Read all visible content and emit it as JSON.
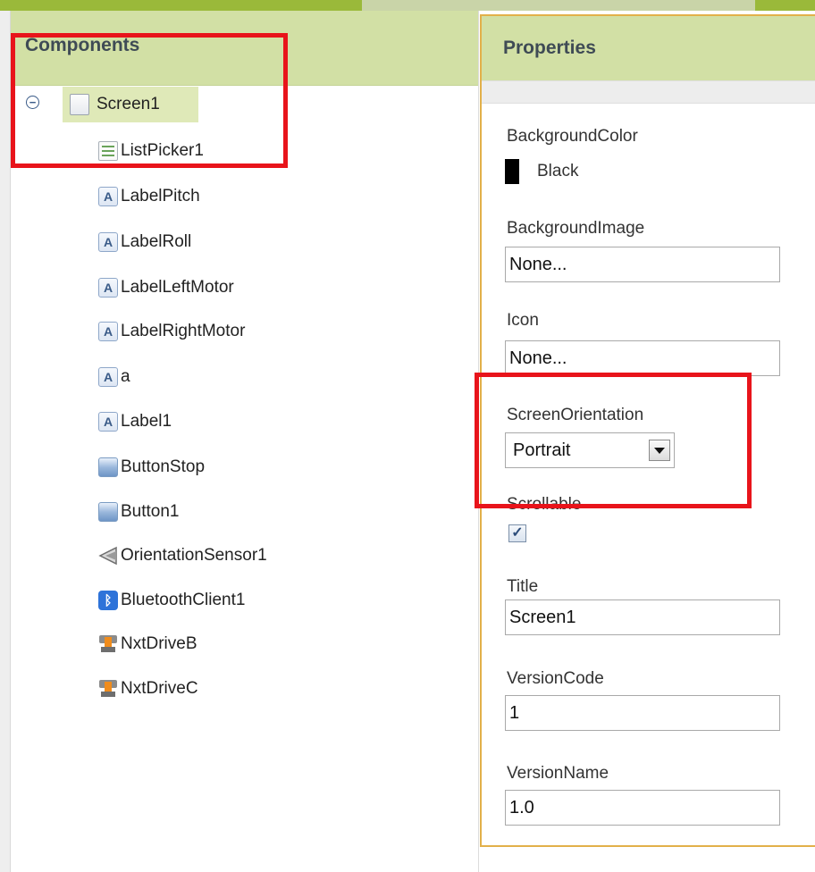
{
  "components": {
    "header": "Components",
    "collapse_toggle": "⊖",
    "screen": "Screen1",
    "items": [
      {
        "label": "ListPicker1",
        "icon": "list-picker-icon"
      },
      {
        "label": "LabelPitch",
        "icon": "label-icon"
      },
      {
        "label": "LabelRoll",
        "icon": "label-icon"
      },
      {
        "label": "LabelLeftMotor",
        "icon": "label-icon"
      },
      {
        "label": "LabelRightMotor",
        "icon": "label-icon"
      },
      {
        "label": "a",
        "icon": "label-icon"
      },
      {
        "label": "Label1",
        "icon": "label-icon"
      },
      {
        "label": "ButtonStop",
        "icon": "button-icon"
      },
      {
        "label": "Button1",
        "icon": "button-icon"
      },
      {
        "label": "OrientationSensor1",
        "icon": "orientation-sensor-icon"
      },
      {
        "label": "BluetoothClient1",
        "icon": "bluetooth-icon"
      },
      {
        "label": "NxtDriveB",
        "icon": "nxt-drive-icon"
      },
      {
        "label": "NxtDriveC",
        "icon": "nxt-drive-icon"
      }
    ],
    "label_icon_glyph": "A",
    "bluetooth_icon_glyph": "ᛒ"
  },
  "properties": {
    "header": "Properties",
    "background_color": {
      "label": "BackgroundColor",
      "value": "Black",
      "swatch": "#000000"
    },
    "background_image": {
      "label": "BackgroundImage",
      "value": "None..."
    },
    "icon": {
      "label": "Icon",
      "value": "None..."
    },
    "screen_orientation": {
      "label": "ScreenOrientation",
      "value": "Portrait"
    },
    "scrollable": {
      "label": "Scrollable",
      "checked": true,
      "check_glyph": "✓"
    },
    "title": {
      "label": "Title",
      "value": "Screen1"
    },
    "version_code": {
      "label": "VersionCode",
      "value": "1"
    },
    "version_name": {
      "label": "VersionName",
      "value": "1.0"
    }
  },
  "colors": {
    "header_bg": "#d2e0a5",
    "top_bar": "#9ab93a",
    "selection_bg": "#dfe9b8",
    "properties_border": "#e2b04a",
    "highlight_red": "#e8141b"
  }
}
